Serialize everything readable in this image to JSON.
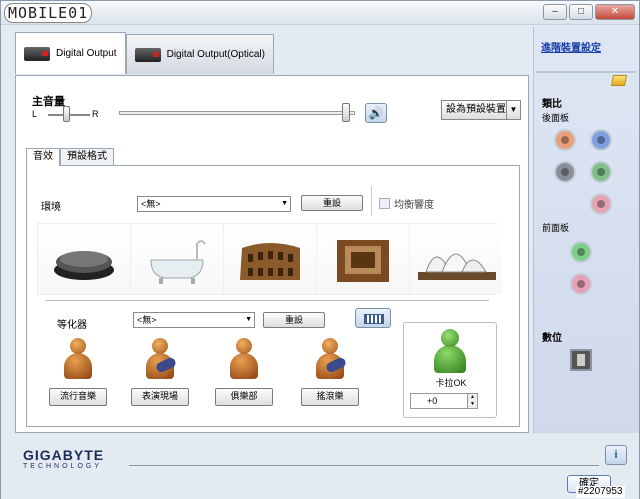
{
  "window": {
    "logo_text": "MOBILE01",
    "minimize": "–",
    "maximize": "□",
    "close": "✕"
  },
  "tabs": [
    {
      "label": "Digital Output"
    },
    {
      "label": "Digital Output(Optical)"
    }
  ],
  "volume": {
    "label": "主音量",
    "left": "L",
    "right": "R",
    "default_device_button": "設為預設裝置"
  },
  "subtabs": [
    {
      "label": "音效"
    },
    {
      "label": "預設格式"
    }
  ],
  "environment": {
    "label": "環境",
    "value": "<無>",
    "reset": "重設",
    "equalize_label": "均衡響度",
    "presets": [
      "stone",
      "bathtub",
      "colosseum",
      "room",
      "opera-house"
    ]
  },
  "equalizer": {
    "label": "等化器",
    "value": "<無>",
    "reset": "重設",
    "genres": [
      {
        "label": "流行音樂"
      },
      {
        "label": "表演現場"
      },
      {
        "label": "俱樂部"
      },
      {
        "label": "搖滾樂"
      }
    ],
    "karaoke": {
      "label": "卡拉OK",
      "value": "+0"
    }
  },
  "sidebar": {
    "advanced_link": "進階裝置設定",
    "analog_label": "類比",
    "rear_label": "後面板",
    "front_label": "前面板",
    "digital_label": "數位",
    "jack_colors": [
      "#e7a07a",
      "#7f9fe0",
      "#8a8f99",
      "#7fbf8a",
      "#e7a3b5",
      "#7fcf8a",
      "#e7a3b5"
    ]
  },
  "footer": {
    "brand": "GIGABYTE",
    "brand_sub": "TECHNOLOGY",
    "ok_button": "確定",
    "info": "i"
  },
  "watermark": "#2207953"
}
